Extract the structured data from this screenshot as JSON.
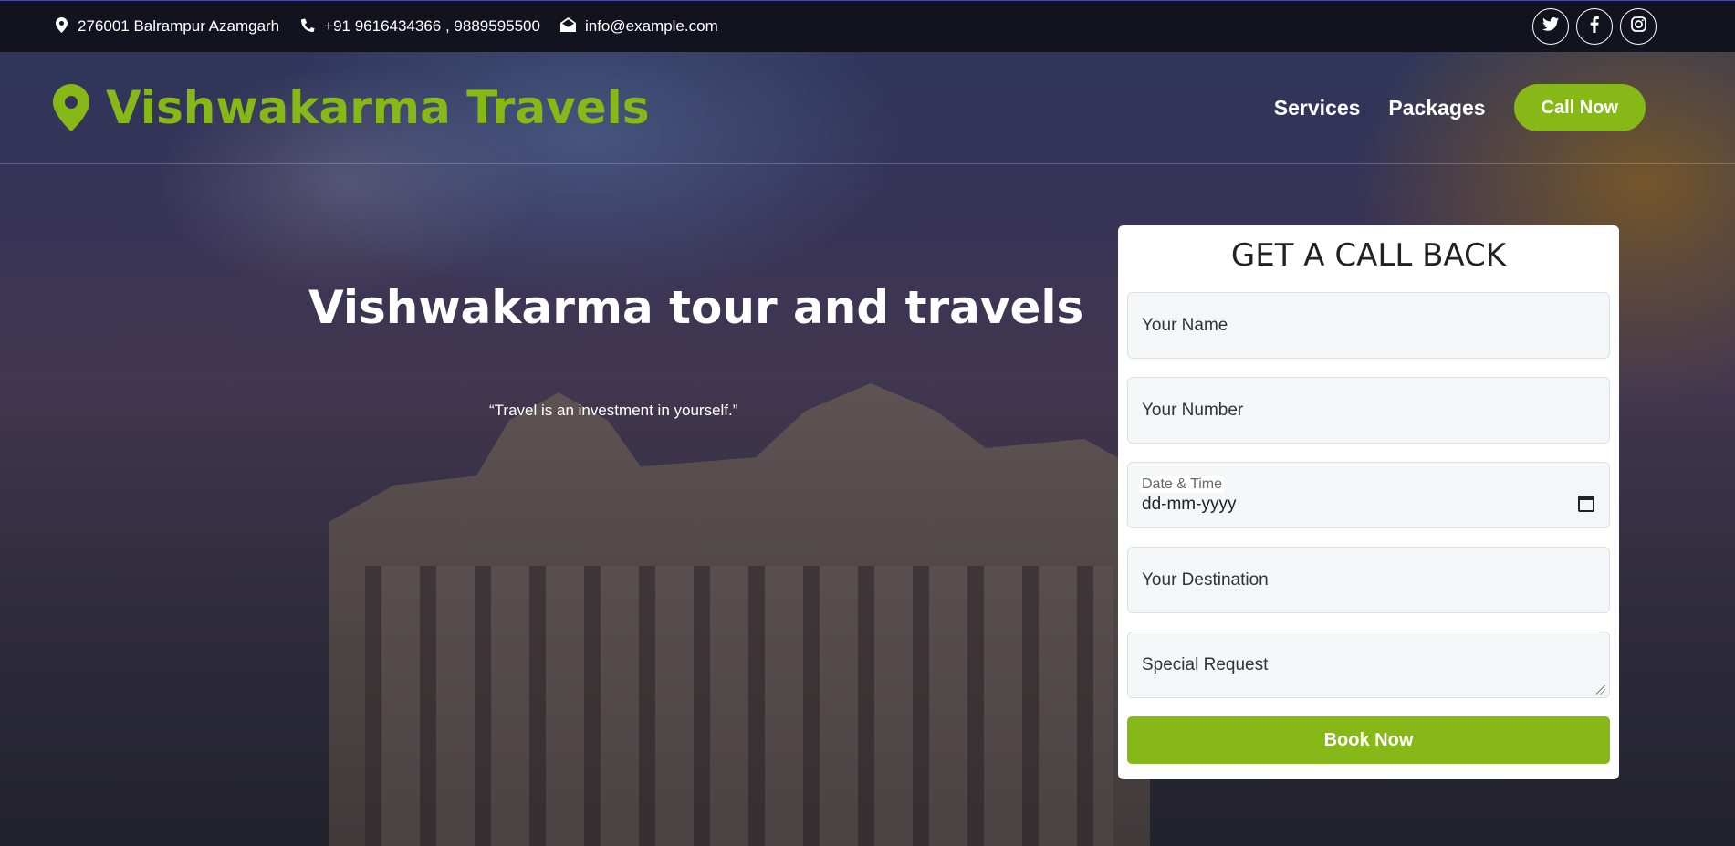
{
  "topbar": {
    "address": "276001 Balrampur Azamgarh",
    "phone": "+91 9616434366 , 9889595500",
    "email": "info@example.com",
    "social": [
      {
        "name": "twitter-icon",
        "glyph": "𝕏"
      },
      {
        "name": "facebook-icon",
        "glyph": "f"
      },
      {
        "name": "instagram-icon",
        "glyph": "◎"
      }
    ]
  },
  "navbar": {
    "brand": "Vishwakarma Travels",
    "links": [
      "Services",
      "Packages"
    ],
    "call_button": "Call Now"
  },
  "hero": {
    "title": "Vishwakarma tour and travels",
    "quote": "“Travel is an investment in yourself.”"
  },
  "form": {
    "title": "GET A CALL BACK",
    "name_placeholder": "Your Name",
    "number_placeholder": "Your Number",
    "date_label": "Date & Time",
    "date_value": "dd-mm-yyyy",
    "destination_placeholder": "Your Destination",
    "request_placeholder": "Special Request",
    "submit": "Book Now"
  },
  "colors": {
    "accent": "#86b817",
    "topbar_bg": "#13131f"
  }
}
